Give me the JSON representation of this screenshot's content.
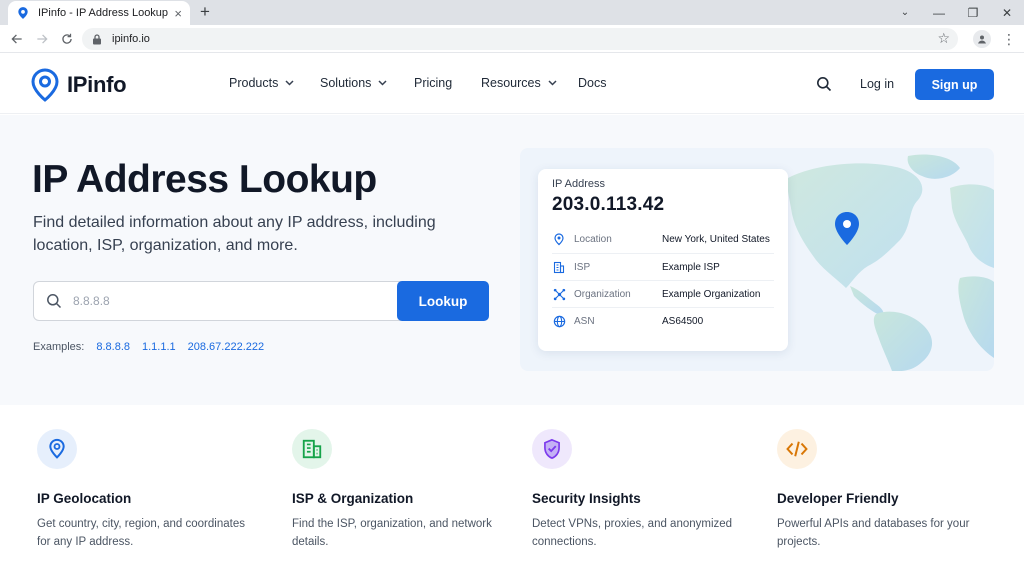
{
  "browser": {
    "tab_title": "IPinfo - IP Address Lookup and N...",
    "url": "ipinfo.io",
    "new_tab": "+",
    "close_tab": "×"
  },
  "nav": {
    "logo_text": "IPinfo",
    "items": [
      {
        "label": "Products",
        "has_dropdown": true
      },
      {
        "label": "Solutions",
        "has_dropdown": true
      },
      {
        "label": "Pricing",
        "has_dropdown": false
      },
      {
        "label": "Resources",
        "has_dropdown": true
      },
      {
        "label": "Docs",
        "has_dropdown": false
      }
    ],
    "login": "Log in",
    "signup": "Sign up"
  },
  "hero": {
    "title": "IP Address Lookup",
    "subtitle": "Find detailed information about any IP address, including location, ISP, organization, and more.",
    "search_placeholder": "8.8.8.8",
    "search_value": "",
    "lookup_button": "Lookup",
    "examples_label": "Examples:",
    "examples": [
      "8.8.8.8",
      "1.1.1.1",
      "208.67.222.222"
    ]
  },
  "ip_card": {
    "label": "IP Address",
    "ip": "203.0.113.42",
    "rows": [
      {
        "key": "Location",
        "value": "New York, United States",
        "icon": "location-pin-icon"
      },
      {
        "key": "ISP",
        "value": "Example ISP",
        "icon": "building-icon"
      },
      {
        "key": "Organization",
        "value": "Example Organization",
        "icon": "network-icon"
      },
      {
        "key": "ASN",
        "value": "AS64500",
        "icon": "globe-icon"
      }
    ]
  },
  "features": [
    {
      "title": "IP Geolocation",
      "desc": "Get country, city, region, and coordinates for any IP address.",
      "icon": "location-pin-icon",
      "color": "#1a6ae0",
      "bg": "#e6effc"
    },
    {
      "title": "ISP & Organization",
      "desc": "Find the ISP, organization, and network details.",
      "icon": "building-icon",
      "color": "#16a34a",
      "bg": "#e3f5ea"
    },
    {
      "title": "Security Insights",
      "desc": "Detect VPNs, proxies, and anonymized connections.",
      "icon": "shield-icon",
      "color": "#7c3aed",
      "bg": "#efe8fc"
    },
    {
      "title": "Developer Friendly",
      "desc": "Powerful APIs and databases for your projects.",
      "icon": "code-icon",
      "color": "#d97706",
      "bg": "#fdf1e1"
    }
  ],
  "colors": {
    "accent": "#1a6ae0",
    "text": "#111827",
    "hero_bg": "#f7f9fc"
  }
}
